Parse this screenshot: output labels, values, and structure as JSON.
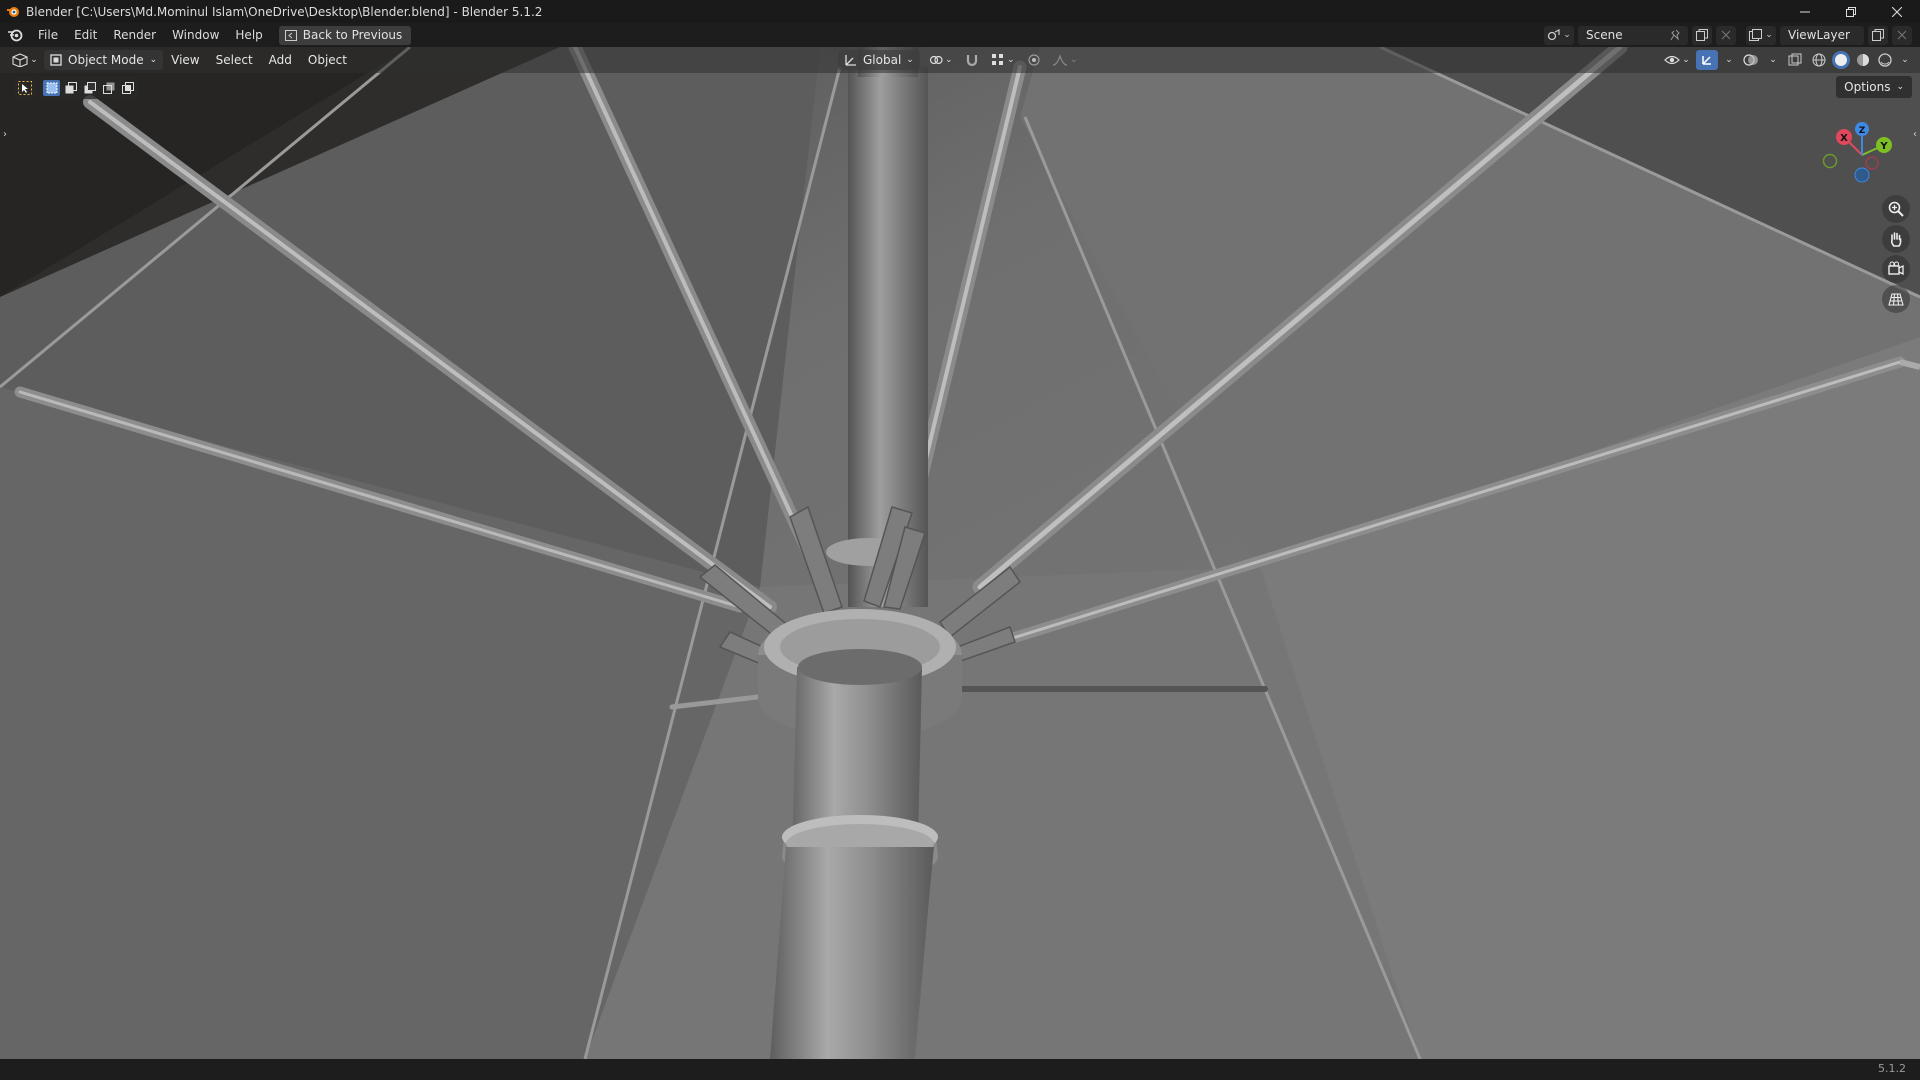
{
  "window": {
    "title": "Blender [C:\\Users\\Md.Mominul Islam\\OneDrive\\Desktop\\Blender.blend] - Blender 5.1.2",
    "minimize_icon": "minimize-icon",
    "maximize_icon": "restore-icon",
    "close_icon": "close-icon"
  },
  "topbar": {
    "menus": [
      "File",
      "Edit",
      "Render",
      "Window",
      "Help"
    ],
    "back_button": "Back to Previous",
    "scene_name": "Scene",
    "view_layer": "ViewLayer"
  },
  "viewport_header": {
    "mode": "Object Mode",
    "menus": [
      "View",
      "Select",
      "Add",
      "Object"
    ],
    "transform_orientation": "Global",
    "options_label": "Options"
  },
  "gizmo": {
    "x_label": "X",
    "y_label": "Y",
    "z_label": "Z"
  },
  "status": {
    "version": "5.1.2"
  },
  "colors": {
    "accent": "#4772b3",
    "x_axis": "#e0475d",
    "y_axis": "#7fbf26",
    "z_axis": "#3d8ae6"
  }
}
